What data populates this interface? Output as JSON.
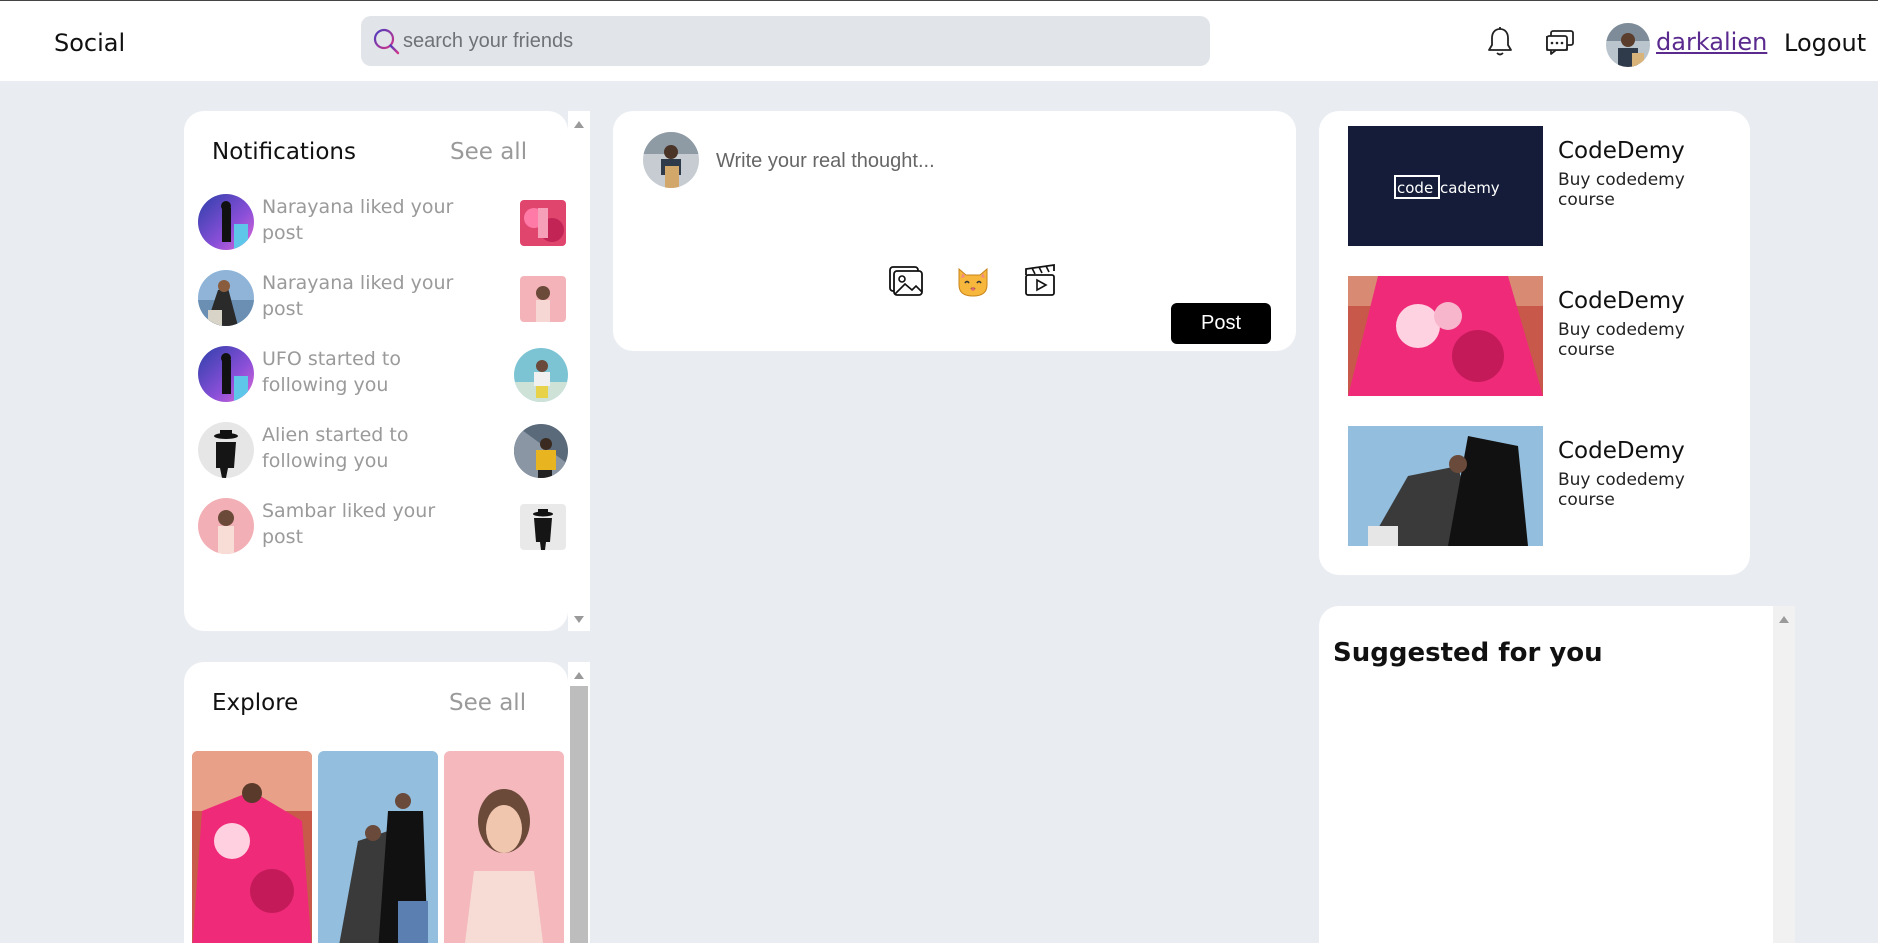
{
  "navbar": {
    "brand": "Social",
    "search_placeholder": "search your friends",
    "username": "darkalien",
    "logout_label": "Logout",
    "icons": [
      "bell-icon",
      "chat-icon",
      "search-icon"
    ]
  },
  "notifications": {
    "title": "Notifications",
    "see_all": "See all",
    "items": [
      {
        "text": "Narayana liked your post",
        "thumb": "square"
      },
      {
        "text": "Narayana liked your post",
        "thumb": "square"
      },
      {
        "text": "UFO started to following you",
        "thumb": "round"
      },
      {
        "text": "Alien started to following you",
        "thumb": "round"
      },
      {
        "text": "Sambar liked your post",
        "thumb": "square"
      }
    ]
  },
  "explore": {
    "title": "Explore",
    "see_all": "See all"
  },
  "composer": {
    "placeholder": "Write your real thought...",
    "post_label": "Post",
    "tools": [
      "photos-icon",
      "cat-emoji-icon",
      "clapperboard-icon"
    ]
  },
  "ads": [
    {
      "title": "CodeDemy",
      "subtitle": "Buy codedemy course",
      "logo_text_a": "code",
      "logo_text_b": "cademy"
    },
    {
      "title": "CodeDemy",
      "subtitle": "Buy codedemy course"
    },
    {
      "title": "CodeDemy",
      "subtitle": "Buy codedemy course"
    }
  ],
  "suggested": {
    "title": "Suggested for you"
  },
  "colors": {
    "page_bg": "#e9ecf1",
    "username_link": "#5a2a8f",
    "post_button": "#000000",
    "codecademy_bg": "#141c3a"
  }
}
